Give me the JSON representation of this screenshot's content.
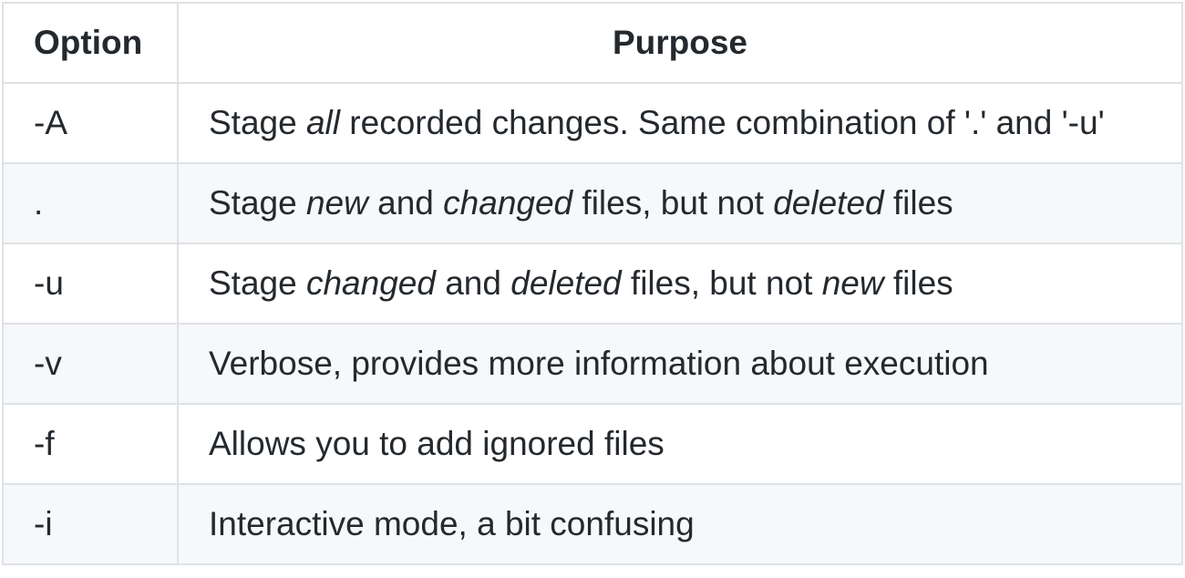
{
  "table": {
    "headers": {
      "option": "Option",
      "purpose": "Purpose"
    },
    "rows": [
      {
        "option": "-A",
        "purpose": [
          {
            "text": "Stage ",
            "em": false
          },
          {
            "text": "all",
            "em": true
          },
          {
            "text": " recorded changes. Same combination of '.' and '-u'",
            "em": false
          }
        ]
      },
      {
        "option": ".",
        "purpose": [
          {
            "text": "Stage ",
            "em": false
          },
          {
            "text": "new",
            "em": true
          },
          {
            "text": " and ",
            "em": false
          },
          {
            "text": "changed",
            "em": true
          },
          {
            "text": " files, but not ",
            "em": false
          },
          {
            "text": "deleted",
            "em": true
          },
          {
            "text": " files",
            "em": false
          }
        ]
      },
      {
        "option": "-u",
        "purpose": [
          {
            "text": "Stage ",
            "em": false
          },
          {
            "text": "changed",
            "em": true
          },
          {
            "text": " and ",
            "em": false
          },
          {
            "text": "deleted",
            "em": true
          },
          {
            "text": " files, but not ",
            "em": false
          },
          {
            "text": "new",
            "em": true
          },
          {
            "text": " files",
            "em": false
          }
        ]
      },
      {
        "option": "-v",
        "purpose": [
          {
            "text": "Verbose, provides more information about execution",
            "em": false
          }
        ]
      },
      {
        "option": "-f",
        "purpose": [
          {
            "text": "Allows you to add ignored files",
            "em": false
          }
        ]
      },
      {
        "option": "-i",
        "purpose": [
          {
            "text": "Interactive mode, a bit confusing",
            "em": false
          }
        ]
      }
    ]
  }
}
